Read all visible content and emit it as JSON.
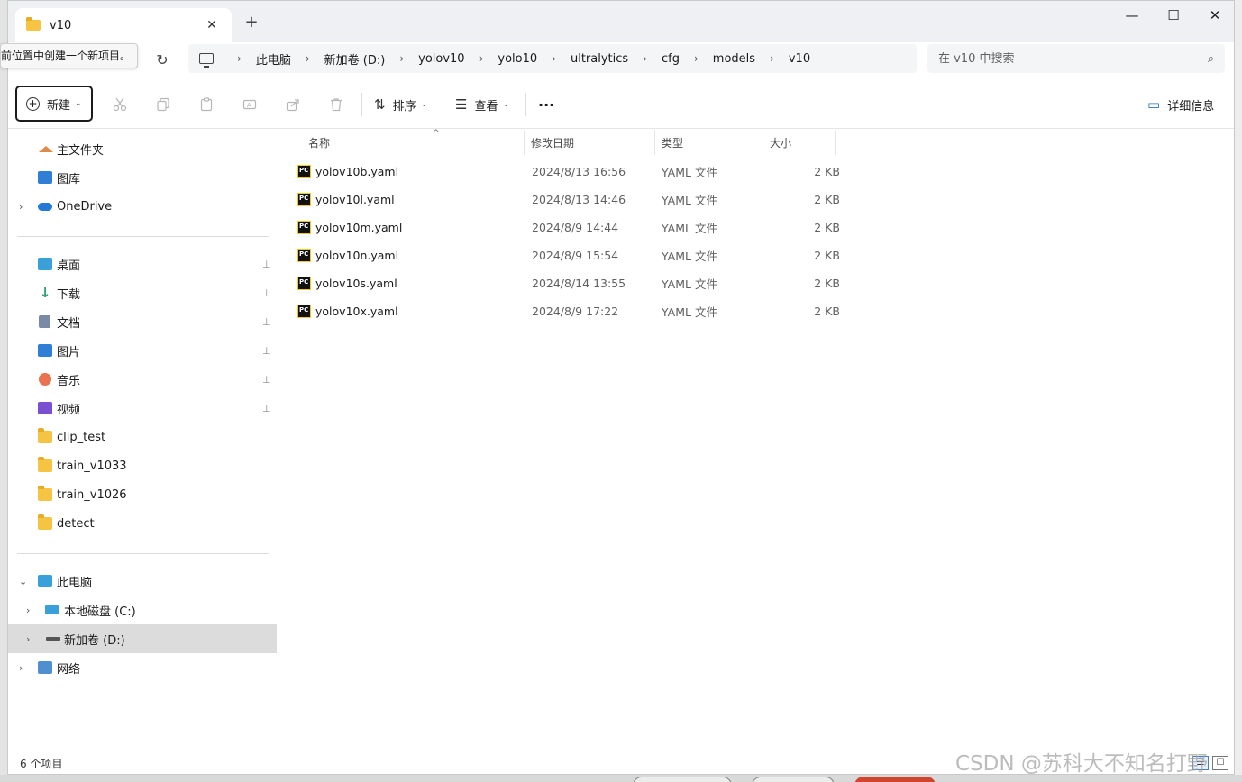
{
  "window": {
    "tab_title": "v10",
    "tab_close": "✕",
    "new_tab": "+",
    "minimize": "—",
    "maximize": "☐",
    "close": "✕"
  },
  "tooltip": "前位置中创建一个新项目。",
  "address": {
    "refresh_icon": "↻",
    "crumbs": [
      "此电脑",
      "新加卷 (D:)",
      "yolov10",
      "yolo10",
      "ultralytics",
      "cfg",
      "models",
      "v10"
    ],
    "separator": "›"
  },
  "search": {
    "placeholder": "在 v10 中搜索",
    "icon": "⌕"
  },
  "toolbar": {
    "new_label": "新建",
    "new_icon": "+",
    "chevron": "⌄",
    "sort_label": "排序",
    "view_label": "查看",
    "more_label": "···",
    "details_label": "详细信息",
    "disabled_icons": [
      "cut-icon",
      "copy-icon",
      "paste-icon",
      "rename-icon",
      "share-icon",
      "delete-icon"
    ]
  },
  "sidebar": {
    "quick": [
      {
        "label": "主文件夹",
        "icon": "home-icon"
      },
      {
        "label": "图库",
        "icon": "gallery-icon"
      },
      {
        "label": "OneDrive",
        "icon": "onedrive-icon",
        "expandable": true
      }
    ],
    "pinned": [
      {
        "label": "桌面",
        "icon": "desktop-icon",
        "pinned": true
      },
      {
        "label": "下载",
        "icon": "download-icon",
        "pinned": true
      },
      {
        "label": "文档",
        "icon": "documents-icon",
        "pinned": true
      },
      {
        "label": "图片",
        "icon": "pictures-icon",
        "pinned": true
      },
      {
        "label": "音乐",
        "icon": "music-icon",
        "pinned": true
      },
      {
        "label": "视频",
        "icon": "videos-icon",
        "pinned": true
      },
      {
        "label": "clip_test",
        "icon": "folder-icon"
      },
      {
        "label": "train_v1033",
        "icon": "folder-icon"
      },
      {
        "label": "train_v1026",
        "icon": "folder-icon"
      },
      {
        "label": "detect",
        "icon": "folder-icon"
      }
    ],
    "pc": {
      "label": "此电脑",
      "icon": "this-pc-icon",
      "expanded": true
    },
    "drives": [
      {
        "label": "本地磁盘 (C:)",
        "icon": "drive-c-icon",
        "selected": false
      },
      {
        "label": "新加卷 (D:)",
        "icon": "drive-d-icon",
        "selected": true
      }
    ],
    "network": {
      "label": "网络",
      "icon": "network-icon"
    },
    "pin_glyph": "📌",
    "expand_glyph": "›",
    "expanded_glyph": "⌄"
  },
  "columns": [
    "名称",
    "修改日期",
    "类型",
    "大小"
  ],
  "sort_indicator": "^",
  "files": [
    {
      "name": "yolov10b.yaml",
      "date": "2024/8/13 16:56",
      "type": "YAML 文件",
      "size": "2 KB"
    },
    {
      "name": "yolov10l.yaml",
      "date": "2024/8/13 14:46",
      "type": "YAML 文件",
      "size": "2 KB"
    },
    {
      "name": "yolov10m.yaml",
      "date": "2024/8/9 14:44",
      "type": "YAML 文件",
      "size": "2 KB"
    },
    {
      "name": "yolov10n.yaml",
      "date": "2024/8/9 15:54",
      "type": "YAML 文件",
      "size": "2 KB"
    },
    {
      "name": "yolov10s.yaml",
      "date": "2024/8/14 13:55",
      "type": "YAML 文件",
      "size": "2 KB"
    },
    {
      "name": "yolov10x.yaml",
      "date": "2024/8/9 17:22",
      "type": "YAML 文件",
      "size": "2 KB"
    }
  ],
  "file_icon_text": "PC",
  "status": {
    "count": "6 个项目"
  },
  "watermark": "CSDN @苏科大不知名打野"
}
